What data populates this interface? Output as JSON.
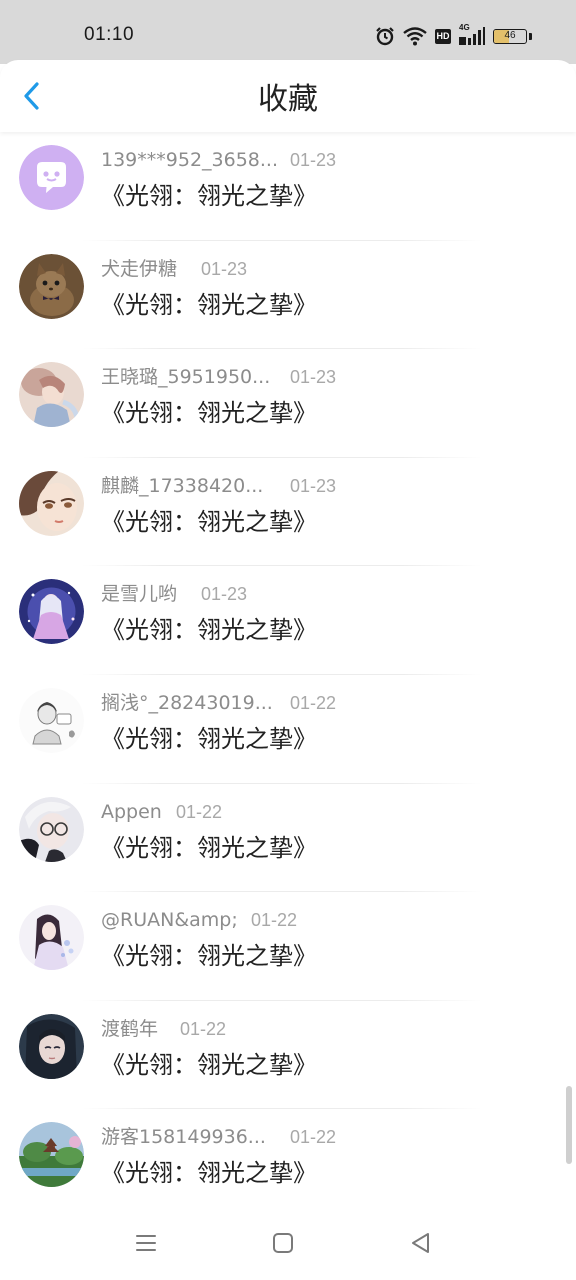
{
  "status_bar": {
    "time": "01:10",
    "battery_level": "46",
    "battery_fraction": 0.46,
    "battery_color": "#e3c06b",
    "network": "4G",
    "hd_label": "HD",
    "icons": [
      "alarm-icon",
      "wifi-icon",
      "hd-icon",
      "signal-icon",
      "battery-icon"
    ]
  },
  "header": {
    "title": "收藏",
    "back_icon": "chevron-left-icon",
    "accent_color": "#1f9ae8"
  },
  "items": [
    {
      "username": "139***952_3658...",
      "date": "01-23",
      "title": "《光翎：翎光之挚》",
      "avatar": "default-chat-avatar"
    },
    {
      "username": "犬走伊糖",
      "date": "01-23",
      "title": "《光翎：翎光之挚》",
      "avatar": "kitten-photo-avatar"
    },
    {
      "username": "王晓璐_5951950...",
      "date": "01-23",
      "title": "《光翎：翎光之挚》",
      "avatar": "illustrated-portrait-avatar"
    },
    {
      "username": "麒麟_17338420...",
      "date": "01-23",
      "title": "《光翎：翎光之挚》",
      "avatar": "anime-face-avatar"
    },
    {
      "username": "是雪儿哟",
      "date": "01-23",
      "title": "《光翎：翎光之挚》",
      "avatar": "fantasy-girl-avatar"
    },
    {
      "username": "搁浅°_28243019...",
      "date": "01-22",
      "title": "《光翎：翎光之挚》",
      "avatar": "sketch-girl-avatar"
    },
    {
      "username": "Appen",
      "date": "01-22",
      "title": "《光翎：翎光之挚》",
      "avatar": "glasses-boy-avatar"
    },
    {
      "username": "@RUAN&amp;",
      "date": "01-22",
      "title": "《光翎：翎光之挚》",
      "avatar": "hanfu-girl-avatar"
    },
    {
      "username": "渡鹤年",
      "date": "01-22",
      "title": "《光翎：翎光之挚》",
      "avatar": "dark-hair-avatar"
    },
    {
      "username": "游客158149936...",
      "date": "01-22",
      "title": "《光翎：翎光之挚》",
      "avatar": "pagoda-landscape-avatar"
    }
  ],
  "nav_bar": {
    "icons": [
      "menu-icon",
      "home-square-icon",
      "back-triangle-icon"
    ]
  }
}
